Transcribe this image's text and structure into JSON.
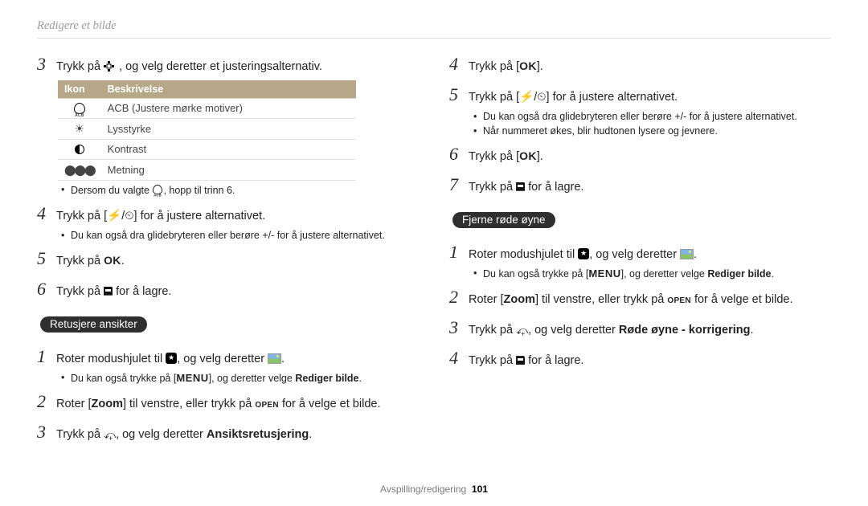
{
  "header": {
    "title": "Redigere et bilde"
  },
  "footer": {
    "section": "Avspilling/redigering",
    "page": "101"
  },
  "table": {
    "h_icon": "Ikon",
    "h_desc": "Beskrivelse",
    "rows": [
      {
        "desc": "ACB (Justere mørke motiver)"
      },
      {
        "desc": "Lysstyrke"
      },
      {
        "desc": "Kontrast"
      },
      {
        "desc": "Metning"
      }
    ]
  },
  "left": {
    "s3": {
      "num": "3",
      "pre": "Trykk på ",
      "post": ", og velg deretter et justeringsalternativ."
    },
    "note_acb": {
      "pre": "Dersom du valgte ",
      "post": ", hopp til trinn 6."
    },
    "s4": {
      "num": "4",
      "pre": "Trykk på [",
      "sep": "/",
      "post": "] for å justere alternativet."
    },
    "s4_note": "Du kan også dra glidebryteren eller berøre +/- for å justere alternativet.",
    "s5": {
      "num": "5",
      "pre": "Trykk på ",
      "ok": "OK",
      "post": "."
    },
    "s6": {
      "num": "6",
      "pre": "Trykk på ",
      "post": "for å lagre."
    },
    "pill_faces": "Retusjere ansikter",
    "f1": {
      "num": "1",
      "pre": "Roter modushjulet til ",
      "mid": ", og velg deretter ",
      "end": "."
    },
    "f1_note": {
      "pre": "Du kan også trykke på [",
      "menu": "MENU",
      "mid": "], og deretter velge ",
      "bold": "Rediger bilde",
      "end": "."
    },
    "f2": {
      "num": "2",
      "pre": "Roter [",
      "zoom": "Zoom",
      "mid": "] til venstre, eller trykk på ",
      "open": "open",
      "post": " for å velge et bilde."
    },
    "f3": {
      "num": "3",
      "pre": "Trykk på ",
      "mid": ", og velg deretter ",
      "bold": "Ansiktsretusjering",
      "end": "."
    }
  },
  "right": {
    "s4": {
      "num": "4",
      "pre": "Trykk på [",
      "ok": "OK",
      "post": "]."
    },
    "s5": {
      "num": "5",
      "pre": "Trykk på [",
      "sep": "/",
      "post": "] for å justere alternativet."
    },
    "s5_n1": "Du kan også dra glidebryteren eller berøre +/- for å justere alternativet.",
    "s5_n2": "Når nummeret økes, blir hudtonen lysere og jevnere.",
    "s6": {
      "num": "6",
      "pre": "Trykk på [",
      "ok": "OK",
      "post": "]."
    },
    "s7": {
      "num": "7",
      "pre": "Trykk på ",
      "post": " for å lagre."
    },
    "pill_redeye": "Fjerne røde øyne",
    "r1": {
      "num": "1",
      "pre": "Roter modushjulet til ",
      "mid": ", og velg deretter ",
      "end": "."
    },
    "r1_note": {
      "pre": "Du kan også trykke på [",
      "menu": "MENU",
      "mid": "], og deretter velge ",
      "bold": "Rediger bilde",
      "end": "."
    },
    "r2": {
      "num": "2",
      "pre": "Roter [",
      "zoom": "Zoom",
      "mid": "] til venstre, eller trykk på ",
      "open": "open",
      "post": " for å velge et bilde."
    },
    "r3": {
      "num": "3",
      "pre": "Trykk på ",
      "mid": ", og velg deretter ",
      "bold": "Røde øyne - korrigering",
      "end": "."
    },
    "r4": {
      "num": "4",
      "pre": "Trykk på ",
      "post": " for å lagre."
    }
  }
}
